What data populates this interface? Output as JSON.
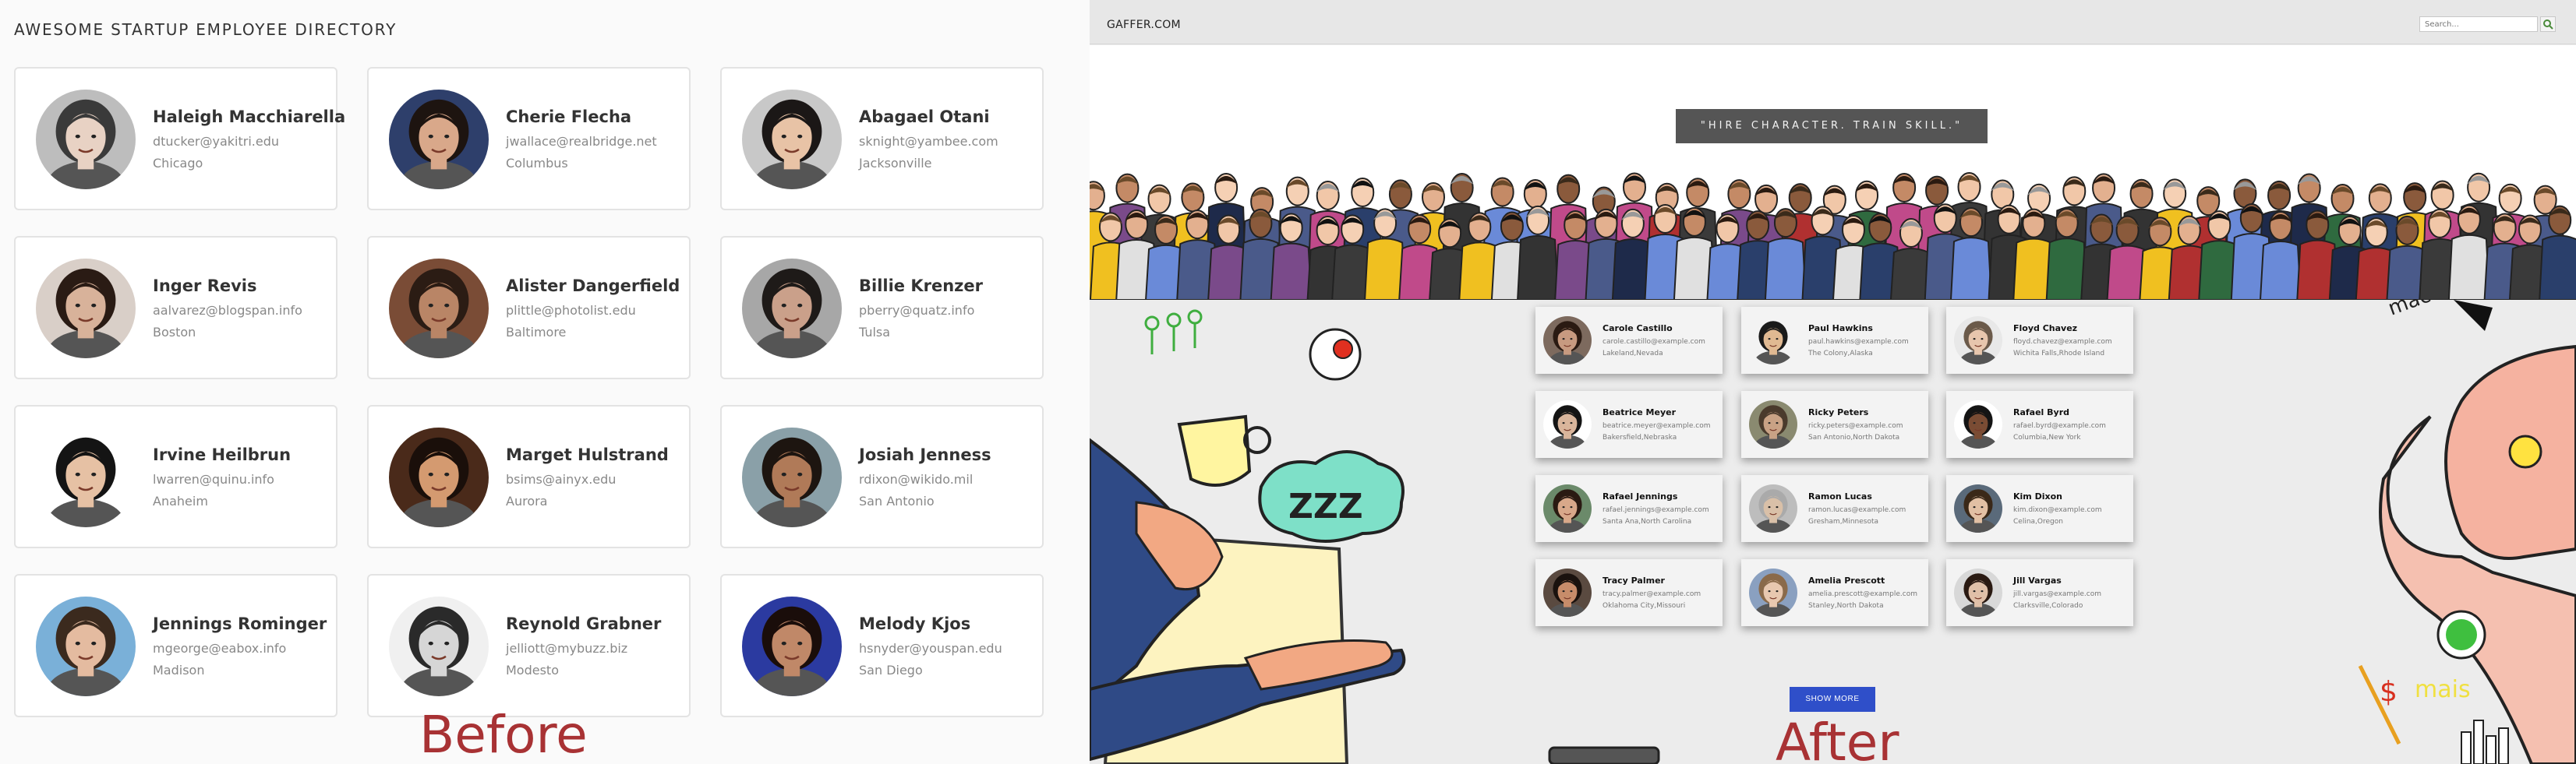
{
  "before": {
    "title": "AWESOME STARTUP EMPLOYEE DIRECTORY",
    "label": "Before",
    "employees": [
      {
        "name": "Haleigh Macchiarella",
        "email": "dtucker@yakitri.edu",
        "city": "Chicago",
        "skin": "#e8d2c4",
        "hair": "#3a3a3a",
        "bg": "#bdbdbd"
      },
      {
        "name": "Cherie Flecha",
        "email": "jwallace@realbridge.net",
        "city": "Columbus",
        "skin": "#d9a88a",
        "hair": "#1d1410",
        "bg": "#2e3f6b"
      },
      {
        "name": "Abagael Otani",
        "email": "sknight@yambee.com",
        "city": "Jacksonville",
        "skin": "#e8c3a6",
        "hair": "#1b1716",
        "bg": "#c8c8c8"
      },
      {
        "name": "Inger Revis",
        "email": "aalvarez@blogspan.info",
        "city": "Boston",
        "skin": "#d8b29a",
        "hair": "#2a1b14",
        "bg": "#d9cfc8"
      },
      {
        "name": "Alister Dangerfield",
        "email": "plittle@photolist.edu",
        "city": "Baltimore",
        "skin": "#b98566",
        "hair": "#2b1c14",
        "bg": "#7a4c36"
      },
      {
        "name": "Billie Krenzer",
        "email": "pberry@quatz.info",
        "city": "Tulsa",
        "skin": "#caa08a",
        "hair": "#1e1a18",
        "bg": "#a7a7a7"
      },
      {
        "name": "Irvine Heilbrun",
        "email": "lwarren@quinu.info",
        "city": "Anaheim",
        "skin": "#e6c1a4",
        "hair": "#141414",
        "bg": "#ffffff"
      },
      {
        "name": "Marget Hulstrand",
        "email": "bsims@ainyx.edu",
        "city": "Aurora",
        "skin": "#d49a70",
        "hair": "#1a0f0a",
        "bg": "#4a2a1a"
      },
      {
        "name": "Josiah Jenness",
        "email": "rdixon@wikido.mil",
        "city": "San Antonio",
        "skin": "#b07a58",
        "hair": "#1d1510",
        "bg": "#8aa0a8"
      },
      {
        "name": "Jennings Rominger",
        "email": "mgeorge@eabox.info",
        "city": "Madison",
        "skin": "#e4bba0",
        "hair": "#3b2a1e",
        "bg": "#7ab0d8"
      },
      {
        "name": "Reynold Grabner",
        "email": "jelliott@mybuzz.biz",
        "city": "Modesto",
        "skin": "#d6d6d6",
        "hair": "#2a2a2a",
        "bg": "#f0f0f0"
      },
      {
        "name": "Melody Kjos",
        "email": "hsnyder@youspan.edu",
        "city": "San Diego",
        "skin": "#c08868",
        "hair": "#1a0d0a",
        "bg": "#2b3aa0"
      }
    ]
  },
  "after": {
    "brand": "GAFFER.COM",
    "search_placeholder": "Search...",
    "quote": "\"HIRE CHARACTER. TRAIN SKILL.\"",
    "button": "SHOW MORE",
    "label": "After",
    "accent": "#2f4fc9",
    "employees": [
      {
        "name": "Carole Castillo",
        "email": "carole.castillo@example.com",
        "city": "Lakeland,Nevada",
        "skin": "#c79a80",
        "hair": "#2a1a12",
        "bg": "#7d6a5e"
      },
      {
        "name": "Paul Hawkins",
        "email": "paul.hawkins@example.com",
        "city": "The Colony,Alaska",
        "skin": "#e0b992",
        "hair": "#1a1a1a",
        "bg": "#f3f3f3"
      },
      {
        "name": "Floyd Chavez",
        "email": "floyd.chavez@example.com",
        "city": "Wichita Falls,Rhode Island",
        "skin": "#e7c6ad",
        "hair": "#6b5a4a",
        "bg": "#e8e8e8"
      },
      {
        "name": "Beatrice Meyer",
        "email": "beatrice.meyer@example.com",
        "city": "Bakersfield,Nebraska",
        "skin": "#d9b59b",
        "hair": "#141414",
        "bg": "#ffffff"
      },
      {
        "name": "Ricky Peters",
        "email": "ricky.peters@example.com",
        "city": "San Antonio,North Dakota",
        "skin": "#c9a285",
        "hair": "#4a3a2c",
        "bg": "#8a8a70"
      },
      {
        "name": "Rafael Byrd",
        "email": "rafael.byrd@example.com",
        "city": "Columbia,New York",
        "skin": "#7a4c34",
        "hair": "#141414",
        "bg": "#ffffff"
      },
      {
        "name": "Rafael Jennings",
        "email": "rafael.jennings@example.com",
        "city": "Santa Ana,North Carolina",
        "skin": "#d8a88a",
        "hair": "#2a1a12",
        "bg": "#6b8a6a"
      },
      {
        "name": "Ramon Lucas",
        "email": "ramon.lucas@example.com",
        "city": "Gresham,Minnesota",
        "skin": "#d9c0a8",
        "hair": "#aaaaaa",
        "bg": "#bdbdbd"
      },
      {
        "name": "Kim Dixon",
        "email": "kim.dixon@example.com",
        "city": "Celina,Oregon",
        "skin": "#e2c0a4",
        "hair": "#3a2818",
        "bg": "#5a6a7a"
      },
      {
        "name": "Tracy Palmer",
        "email": "tracy.palmer@example.com",
        "city": "Oklahoma City,Missouri",
        "skin": "#c78c6a",
        "hair": "#1a120e",
        "bg": "#5a4a40"
      },
      {
        "name": "Amelia Prescott",
        "email": "amelia.prescott@example.com",
        "city": "Stanley,North Dakota",
        "skin": "#e8c8b0",
        "hair": "#8a6a4a",
        "bg": "#8aa0c0"
      },
      {
        "name": "Jill Vargas",
        "email": "jill.vargas@example.com",
        "city": "Clarksville,Colorado",
        "skin": "#e0c0a8",
        "hair": "#2a1a12",
        "bg": "#d8d8d8"
      }
    ]
  }
}
